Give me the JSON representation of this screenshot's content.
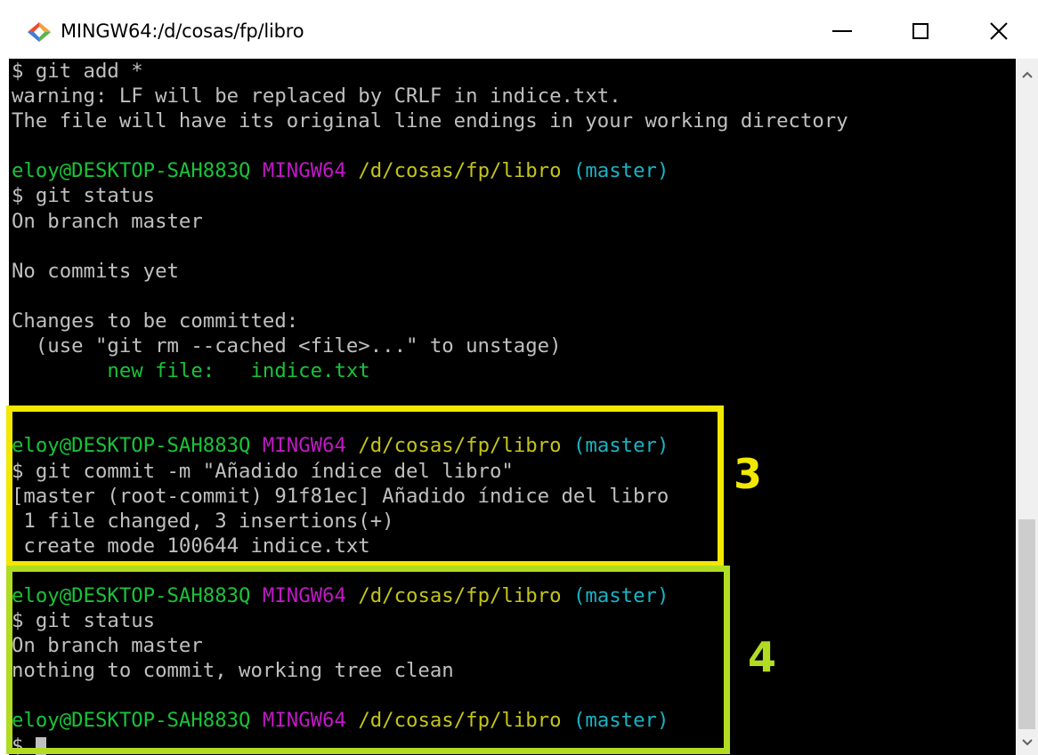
{
  "window": {
    "title": "MINGW64:/d/cosas/fp/libro",
    "app_icon": "git-bash-icon",
    "controls": {
      "minimize_icon": "minimize-icon",
      "maximize_icon": "maximize-icon",
      "close_icon": "close-icon",
      "close_glyph": "✕"
    }
  },
  "colors": {
    "terminal_bg": "#000000",
    "text_default": "#c0c0c0",
    "prompt_user": "#19c43a",
    "prompt_system": "#c118c6",
    "prompt_path": "#c4c41b",
    "prompt_branch": "#1ab3c4",
    "staged_file": "#19c43a",
    "highlight_3": "#f2e800",
    "highlight_4": "#b2dc22"
  },
  "terminal": {
    "lines": [
      {
        "segments": [
          {
            "text": "$ git add *",
            "color": "white"
          }
        ]
      },
      {
        "segments": [
          {
            "text": "warning: LF will be replaced by CRLF in indice.txt.",
            "color": "white"
          }
        ]
      },
      {
        "segments": [
          {
            "text": "The file will have its original line endings in your working directory",
            "color": "white"
          }
        ]
      },
      {
        "segments": []
      },
      {
        "segments": [
          {
            "text": "eloy@DESKTOP-SAH883Q",
            "color": "green"
          },
          {
            "text": " ",
            "color": "white"
          },
          {
            "text": "MINGW64",
            "color": "magenta"
          },
          {
            "text": " ",
            "color": "white"
          },
          {
            "text": "/d/cosas/fp/libro",
            "color": "yellow"
          },
          {
            "text": " ",
            "color": "white"
          },
          {
            "text": "(master)",
            "color": "cyan"
          }
        ]
      },
      {
        "segments": [
          {
            "text": "$ git status",
            "color": "white"
          }
        ]
      },
      {
        "segments": [
          {
            "text": "On branch master",
            "color": "white"
          }
        ]
      },
      {
        "segments": []
      },
      {
        "segments": [
          {
            "text": "No commits yet",
            "color": "white"
          }
        ]
      },
      {
        "segments": []
      },
      {
        "segments": [
          {
            "text": "Changes to be committed:",
            "color": "white"
          }
        ]
      },
      {
        "segments": [
          {
            "text": "  (use \"git rm --cached <file>...\" to unstage)",
            "color": "white"
          }
        ]
      },
      {
        "segments": [
          {
            "text": "        new file:   indice.txt",
            "color": "green"
          }
        ]
      },
      {
        "segments": []
      },
      {
        "segments": []
      },
      {
        "segments": [
          {
            "text": "eloy@DESKTOP-SAH883Q",
            "color": "green"
          },
          {
            "text": " ",
            "color": "white"
          },
          {
            "text": "MINGW64",
            "color": "magenta"
          },
          {
            "text": " ",
            "color": "white"
          },
          {
            "text": "/d/cosas/fp/libro",
            "color": "yellow"
          },
          {
            "text": " ",
            "color": "white"
          },
          {
            "text": "(master)",
            "color": "cyan"
          }
        ]
      },
      {
        "segments": [
          {
            "text": "$ git commit -m \"Añadido índice del libro\"",
            "color": "white"
          }
        ]
      },
      {
        "segments": [
          {
            "text": "[master (root-commit) 91f81ec] Añadido índice del libro",
            "color": "white"
          }
        ]
      },
      {
        "segments": [
          {
            "text": " 1 file changed, 3 insertions(+)",
            "color": "white"
          }
        ]
      },
      {
        "segments": [
          {
            "text": " create mode 100644 indice.txt",
            "color": "white"
          }
        ]
      },
      {
        "segments": []
      },
      {
        "segments": [
          {
            "text": "eloy@DESKTOP-SAH883Q",
            "color": "green"
          },
          {
            "text": " ",
            "color": "white"
          },
          {
            "text": "MINGW64",
            "color": "magenta"
          },
          {
            "text": " ",
            "color": "white"
          },
          {
            "text": "/d/cosas/fp/libro",
            "color": "yellow"
          },
          {
            "text": " ",
            "color": "white"
          },
          {
            "text": "(master)",
            "color": "cyan"
          }
        ]
      },
      {
        "segments": [
          {
            "text": "$ git status",
            "color": "white"
          }
        ]
      },
      {
        "segments": [
          {
            "text": "On branch master",
            "color": "white"
          }
        ]
      },
      {
        "segments": [
          {
            "text": "nothing to commit, working tree clean",
            "color": "white"
          }
        ]
      },
      {
        "segments": []
      },
      {
        "segments": [
          {
            "text": "eloy@DESKTOP-SAH883Q",
            "color": "green"
          },
          {
            "text": " ",
            "color": "white"
          },
          {
            "text": "MINGW64",
            "color": "magenta"
          },
          {
            "text": " ",
            "color": "white"
          },
          {
            "text": "/d/cosas/fp/libro",
            "color": "yellow"
          },
          {
            "text": " ",
            "color": "white"
          },
          {
            "text": "(master)",
            "color": "cyan"
          }
        ]
      },
      {
        "segments": [
          {
            "text": "$",
            "color": "white"
          }
        ],
        "cursor": true
      }
    ]
  },
  "scrollbar": {
    "up_icon": "scroll-up-arrow-icon",
    "down_icon": "scroll-down-arrow-icon",
    "up_glyph": "⌃",
    "down_glyph": "⌄"
  },
  "annotations": {
    "box_3_label": "3",
    "box_4_label": "4"
  }
}
